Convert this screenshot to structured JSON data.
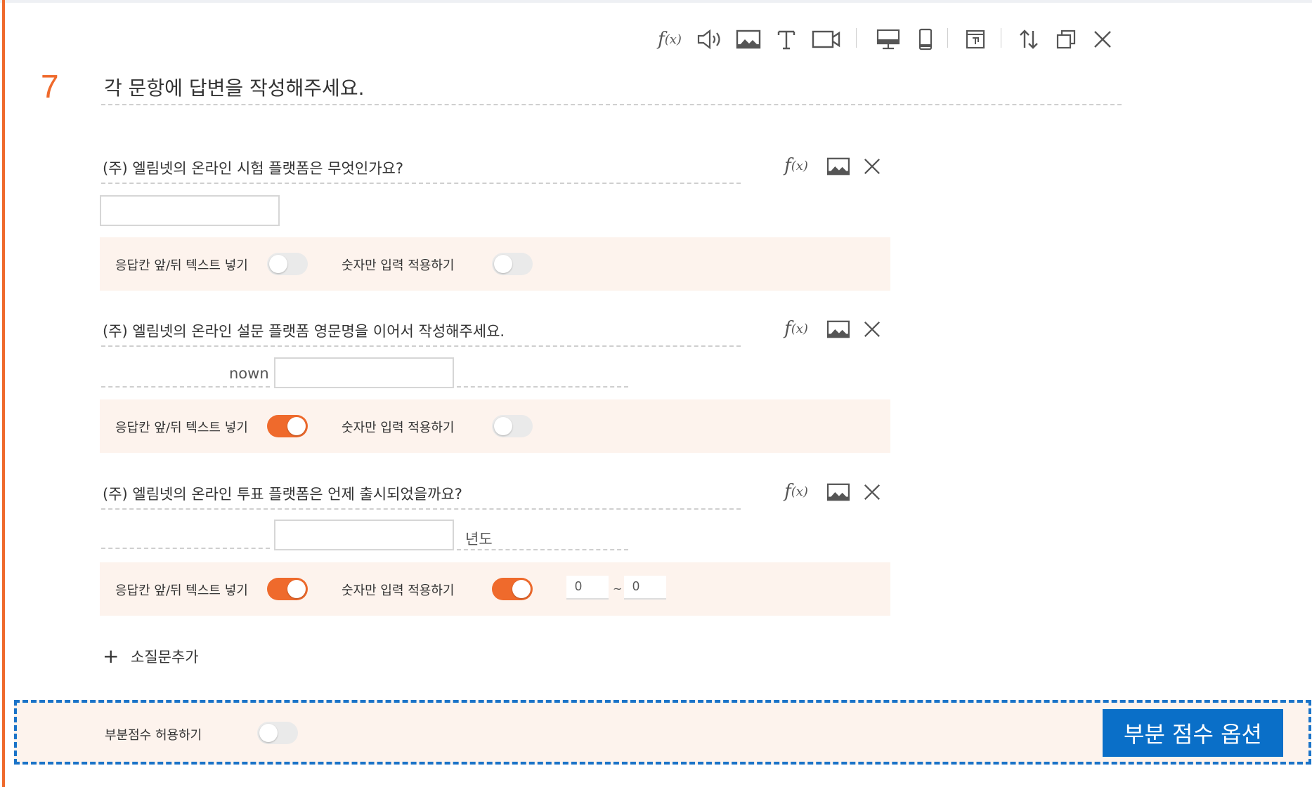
{
  "question": {
    "number": "7",
    "title": "각 문항에 답변을 작성해주세요.",
    "toolbar": [
      {
        "name": "formula",
        "icon": "fx-icon"
      },
      {
        "name": "audio",
        "icon": "speaker-icon"
      },
      {
        "name": "image",
        "icon": "image-icon"
      },
      {
        "name": "text",
        "icon": "text-icon"
      },
      {
        "name": "video",
        "icon": "video-icon"
      },
      {
        "name": "desktop-preview",
        "icon": "monitor-icon"
      },
      {
        "name": "mobile-preview",
        "icon": "mobile-icon"
      },
      {
        "name": "frame",
        "icon": "frame-icon"
      },
      {
        "name": "reorder",
        "icon": "sort-icon"
      },
      {
        "name": "duplicate",
        "icon": "copy-icon"
      },
      {
        "name": "delete",
        "icon": "close-icon"
      }
    ]
  },
  "labels": {
    "affix_toggle": "응답칸 앞/뒤 텍스트 넣기",
    "numeric_toggle": "숫자만 입력 적용하기"
  },
  "subquestions": [
    {
      "text": "(주) 엘림넷의 온라인 시험 플랫폼은 무엇인가요?",
      "answer_value": "",
      "affix_enabled": false,
      "numeric_only": false
    },
    {
      "text": "(주) 엘림넷의 온라인 설문 플랫폼 영문명을 이어서 작성해주세요.",
      "prefix": "nown",
      "answer_value": "",
      "affix_enabled": true,
      "numeric_only": false
    },
    {
      "text": "(주) 엘림넷의 온라인 투표 플랫폼은 언제 출시되었을까요?",
      "suffix": "년도",
      "answer_value": "",
      "affix_enabled": true,
      "numeric_only": true,
      "range_min": "0",
      "range_max": "0",
      "range_separator": "~"
    }
  ],
  "add_subquestion": {
    "plus": "+",
    "label": "소질문추가"
  },
  "partial_score": {
    "label": "부분점수 허용하기",
    "enabled": false,
    "button_label": "부분 점수 옵션",
    "highlight_color": "#1a73c8"
  },
  "colors": {
    "accent": "#ef6a2c",
    "panel": "#fdf3ed",
    "button": "#0a6fc8"
  }
}
